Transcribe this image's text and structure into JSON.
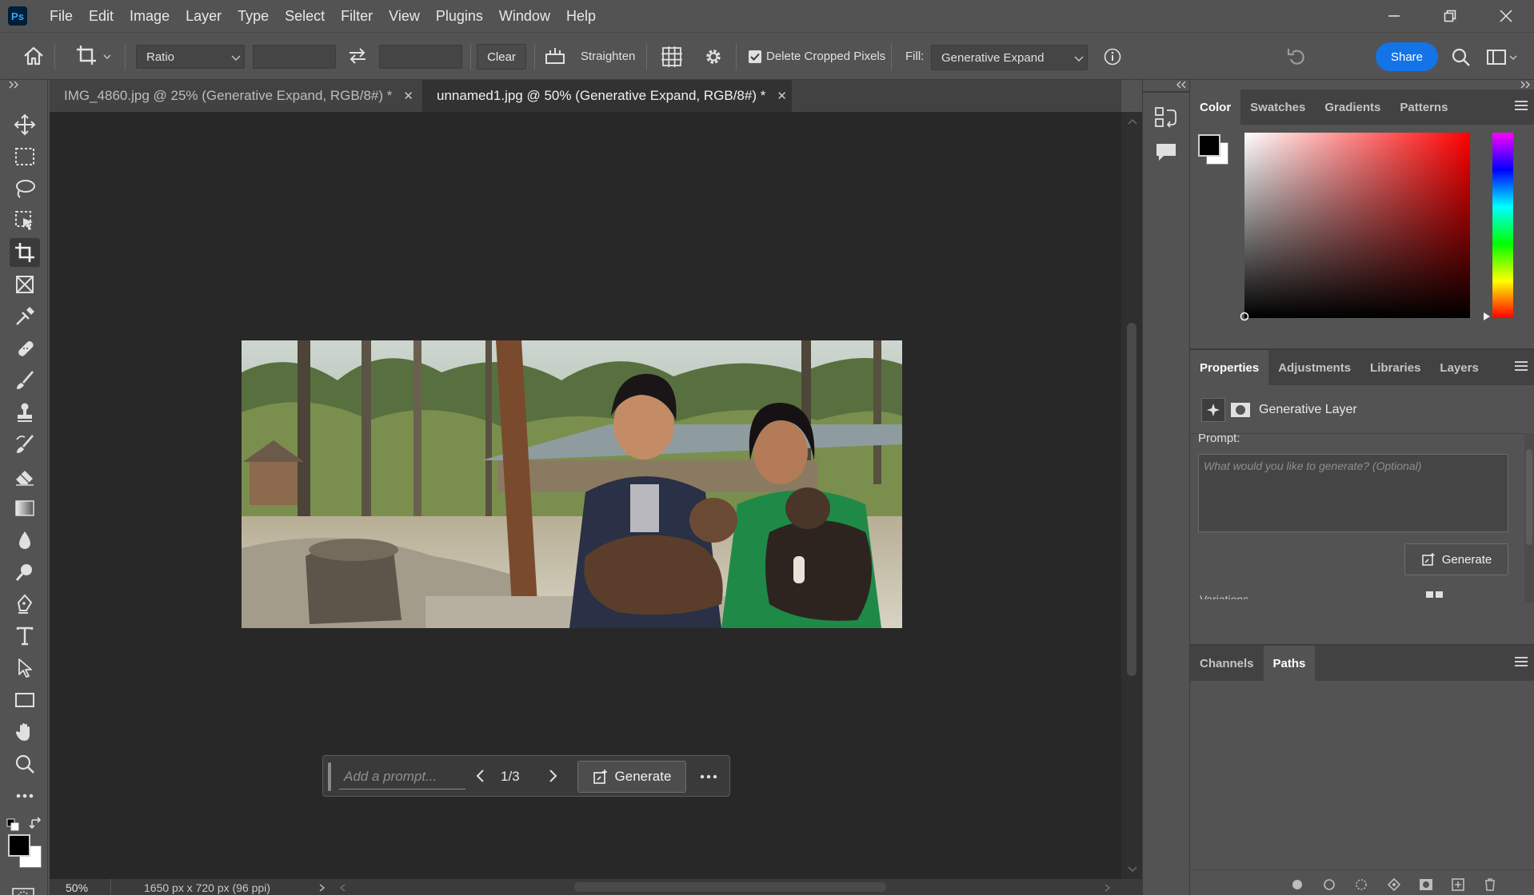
{
  "app": {
    "logo": "Ps"
  },
  "menu": [
    "File",
    "Edit",
    "Image",
    "Layer",
    "Type",
    "Select",
    "Filter",
    "View",
    "Plugins",
    "Window",
    "Help"
  ],
  "options_bar": {
    "ratio_label": "Ratio",
    "clear_label": "Clear",
    "straighten_label": "Straighten",
    "delete_cropped_label": "Delete Cropped Pixels",
    "delete_cropped_checked": true,
    "fill_label": "Fill:",
    "fill_value": "Generative Expand",
    "share_label": "Share"
  },
  "doc_tabs": [
    {
      "label": "IMG_4860.jpg @ 25% (Generative Expand, RGB/8#) *",
      "active": false
    },
    {
      "label": "unnamed1.jpg @ 50% (Generative Expand, RGB/8#) *",
      "active": true
    }
  ],
  "taskbar": {
    "prompt_placeholder": "Add a prompt...",
    "variation_counter": "1/3",
    "generate_label": "Generate"
  },
  "status": {
    "zoom": "50%",
    "doc_info": "1650 px x 720 px (96 ppi)"
  },
  "color_panel": {
    "tabs": [
      "Color",
      "Swatches",
      "Gradients",
      "Patterns"
    ],
    "active_tab": "Color",
    "foreground": "#000000",
    "background": "#ffffff",
    "hue_color": "#ff0000"
  },
  "properties_panel": {
    "tabs": [
      "Properties",
      "Adjustments",
      "Libraries",
      "Layers"
    ],
    "active_tab": "Properties",
    "layer_name": "Generative Layer",
    "prompt_label": "Prompt:",
    "prompt_placeholder": "What would you like to generate? (Optional)",
    "generate_label": "Generate",
    "variations_label": "Variations"
  },
  "paths_panel": {
    "tabs": [
      "Channels",
      "Paths"
    ],
    "active_tab": "Paths"
  },
  "colors": {
    "accent": "#1473e6",
    "canvas": "#282828",
    "ui": "#535353"
  }
}
